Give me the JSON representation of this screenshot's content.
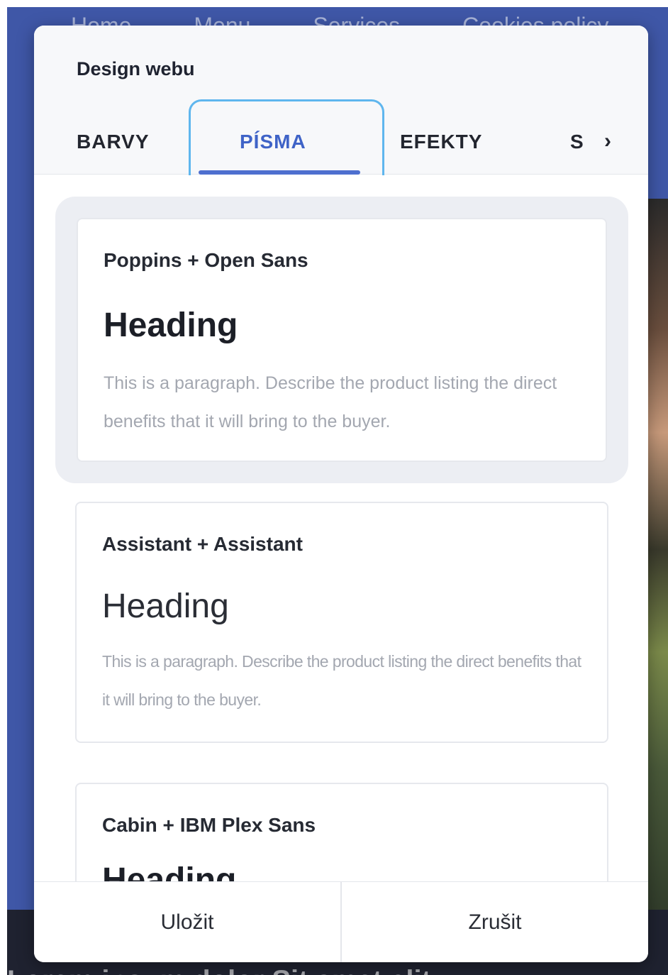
{
  "background": {
    "nav_items": [
      "Home",
      "Menu",
      "Services",
      "Cookies policy"
    ],
    "bottom_text": "Lorem ipsum dolor Sit amet elit"
  },
  "dialog": {
    "title": "Design webu",
    "tabs": [
      {
        "label": "BARVY"
      },
      {
        "label": "PÍSMA",
        "active": true
      },
      {
        "label": "EFEKTY"
      },
      {
        "label": "S"
      }
    ],
    "next_glyph": "›",
    "font_sets": [
      {
        "name": "Poppins + Open Sans",
        "heading": "Heading",
        "paragraph": "This is a paragraph. Describe the product listing the direct benefits that it will bring to the buyer.",
        "selected": true
      },
      {
        "name": "Assistant + Assistant",
        "heading": "Heading",
        "paragraph": "This is a paragraph. Describe the product listing the direct benefits that it will bring to the buyer."
      },
      {
        "name": "Cabin + IBM Plex Sans",
        "heading": "Heading",
        "paragraph": ""
      }
    ],
    "footer": {
      "save_label": "Uložit",
      "cancel_label": "Zrušit"
    }
  },
  "colors": {
    "accent": "#3f63c7",
    "focus_ring": "#5fb6ee",
    "site_background": "#3f57a7"
  }
}
